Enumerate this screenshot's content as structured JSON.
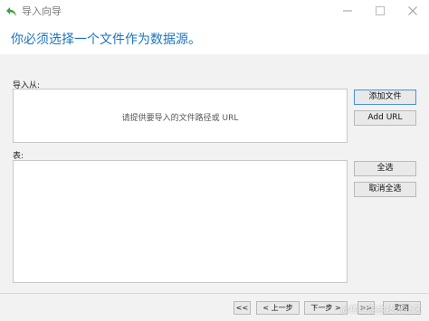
{
  "window": {
    "title": "导入向导",
    "icon": "green-back-arrow-icon",
    "controls": [
      "minimize-icon",
      "maximize-icon",
      "close-icon"
    ]
  },
  "header": {
    "heading": "你必须选择一个文件作为数据源。",
    "heading_color": "#1a73c8"
  },
  "import_from": {
    "label": "导入从:",
    "placeholder": "请提供要导入的文件路径或 URL",
    "add_file_label": "添加文件",
    "add_url_label": "Add URL"
  },
  "tables": {
    "label": "表:",
    "select_all_label": "全选",
    "deselect_all_label": "取消全选"
  },
  "footer": {
    "first_label": "<<",
    "prev_label": "< 上一步",
    "next_label": "下一步 >",
    "last_label": ">>",
    "cancel_label": "取消"
  },
  "watermark": "@稀土掘金技术社区"
}
